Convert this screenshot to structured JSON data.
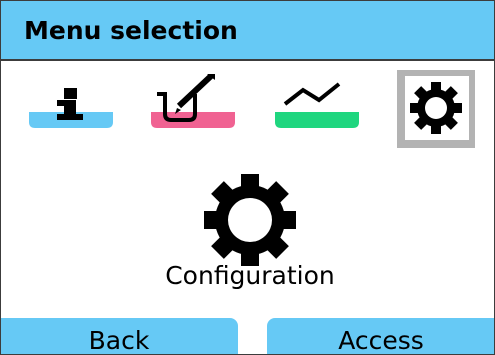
{
  "header": {
    "title": "Menu selection"
  },
  "menu": {
    "items": [
      {
        "icon": "info-icon",
        "accent": "#66c9f5",
        "selected": false
      },
      {
        "icon": "calibration-icon",
        "accent": "#f06292",
        "selected": false
      },
      {
        "icon": "diagnostics-icon",
        "accent": "#1fd67f",
        "selected": false
      },
      {
        "icon": "gear-icon",
        "accent": "#b3b3b3",
        "selected": true
      }
    ],
    "selected_label": "Configuration"
  },
  "softkeys": {
    "left_label": "Back",
    "right_label": "Access"
  },
  "colors": {
    "header_background": "#66c9f5",
    "softkey_background": "#66c9f5",
    "selection_background": "#b3b3b3"
  }
}
